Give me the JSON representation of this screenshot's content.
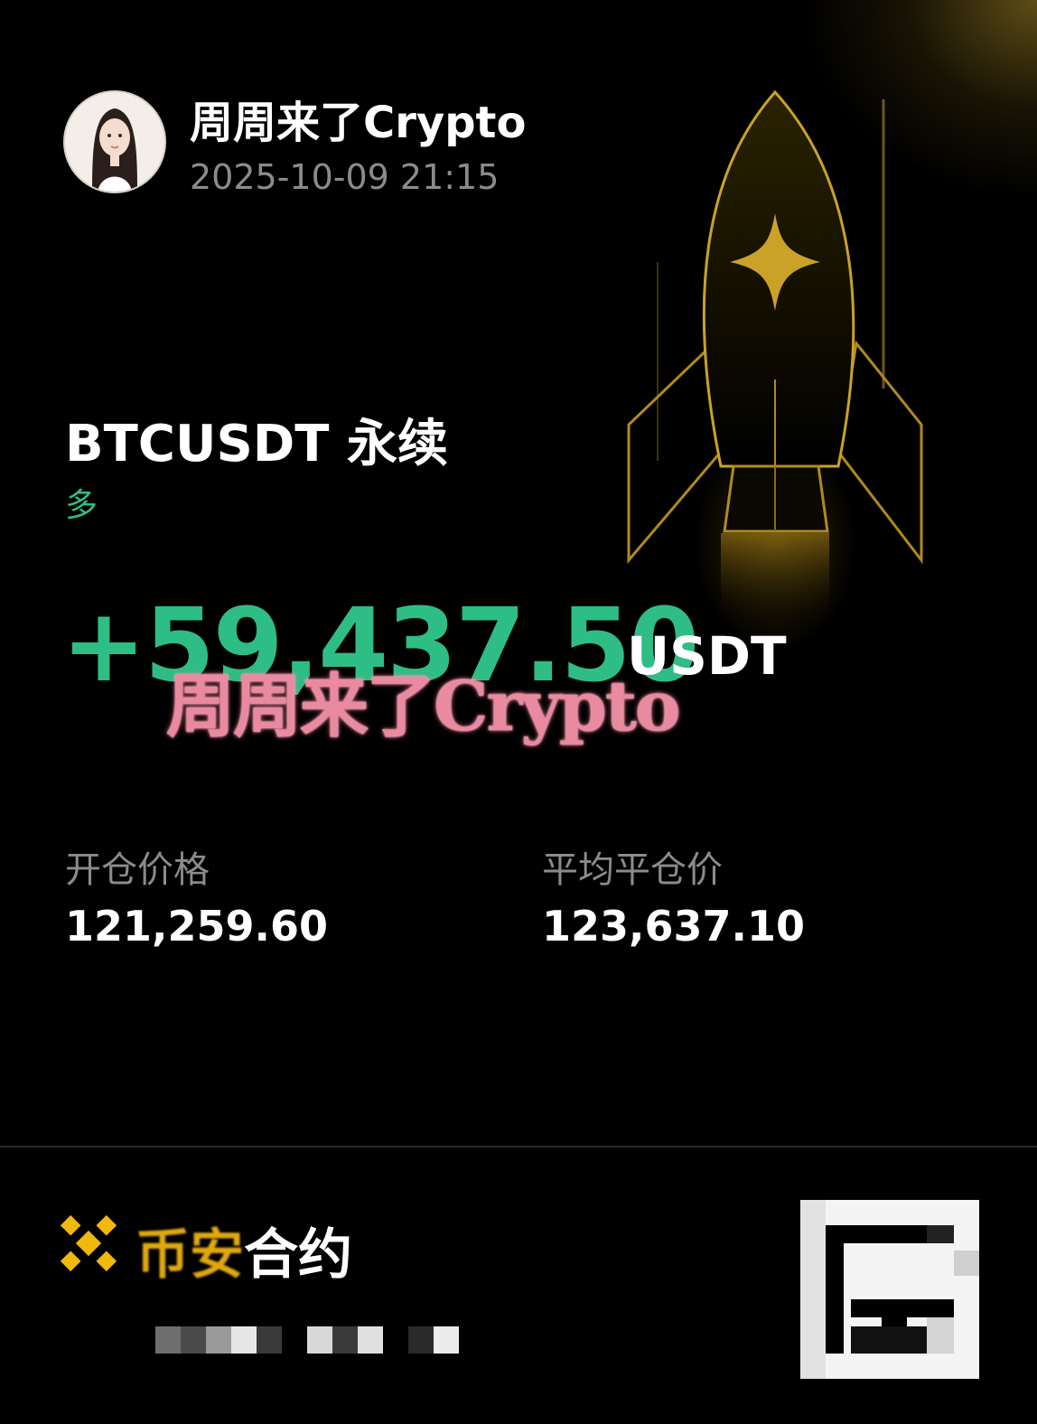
{
  "header": {
    "username": "周周来了Crypto",
    "timestamp": "2025-10-09 21:15",
    "avatar": "avatar"
  },
  "position": {
    "pair": "BTCUSDT 永续",
    "side": "多",
    "pnl": "+59,437.50",
    "pnl_unit": "USDT"
  },
  "watermark": "周周来了Crypto",
  "stats": {
    "entry_label": "开仓价格",
    "entry_value": "121,259.60",
    "close_label": "平均平仓价",
    "close_value": "123,637.10"
  },
  "footer": {
    "brand_icon": "binance-logo-icon",
    "brand_text_prefix": "币安",
    "brand_text_suffix": "合约",
    "qr_icon": "qr-code-icon"
  },
  "colors": {
    "profit_green": "#2ebd85",
    "gold": "#c9a227",
    "muted_gray": "#8b8b8b"
  }
}
